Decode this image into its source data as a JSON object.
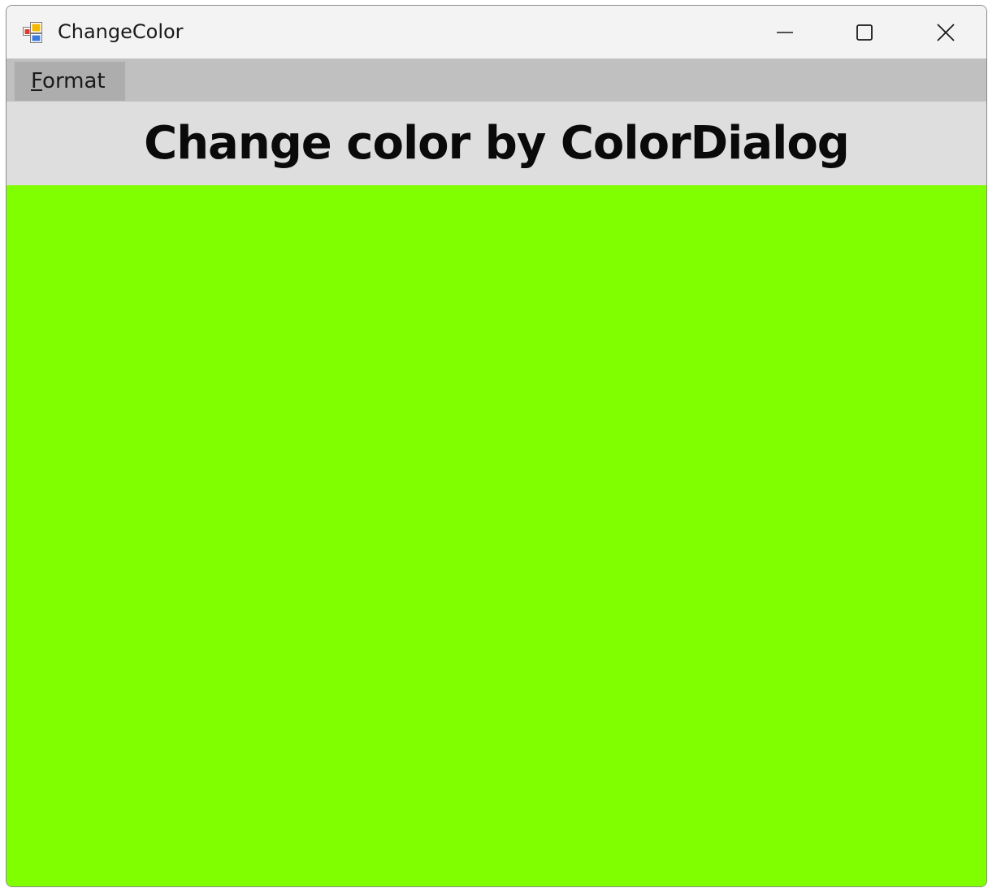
{
  "window": {
    "title": "ChangeColor",
    "icon": "app-form-icon"
  },
  "caption_buttons": {
    "minimize_icon": "minimize-icon",
    "maximize_icon": "maximize-icon",
    "close_icon": "close-icon"
  },
  "menu": {
    "items": [
      {
        "label_mnemonic": "F",
        "label_rest": "ormat"
      }
    ]
  },
  "content": {
    "heading": "Change color by ColorDialog",
    "panel_color": "#80ff00"
  },
  "colors": {
    "titlebar": "#f3f3f3",
    "menubar": "#c0c0c0",
    "menu_item_hover": "#adadad",
    "heading_band": "#dedede"
  }
}
